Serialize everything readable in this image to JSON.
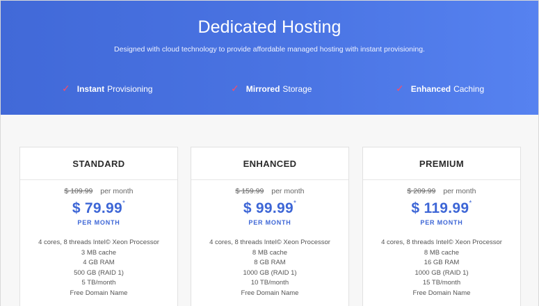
{
  "hero": {
    "title_light": "Dedicated",
    "title_bold": "Hosting",
    "subtitle": "Designed with cloud technology to provide affordable managed hosting with instant provisioning.",
    "features": [
      {
        "bold": "Instant",
        "rest": "Provisioning"
      },
      {
        "bold": "Mirrored",
        "rest": "Storage"
      },
      {
        "bold": "Enhanced",
        "rest": "Caching"
      }
    ]
  },
  "colors": {
    "hero_gradient_start": "#4169d8",
    "hero_gradient_end": "#5682f0",
    "accent_blue": "#3d66d6",
    "check_red": "#ff4b63"
  },
  "plans": [
    {
      "name": "STANDARD",
      "old_price": "$ 109.99",
      "per_month_text": "per month",
      "price": "$ 79.99",
      "price_mark": "*",
      "price_caption": "PER MONTH",
      "features": [
        "4 cores, 8 threads Intel© Xeon Processor",
        "3 MB cache",
        "4 GB RAM",
        "500 GB (RAID 1)",
        "5 TB/month",
        "Free Domain Name"
      ]
    },
    {
      "name": "ENHANCED",
      "old_price": "$ 159.99",
      "per_month_text": "per month",
      "price": "$ 99.99",
      "price_mark": "*",
      "price_caption": "PER MONTH",
      "features": [
        "4 cores, 8 threads Intel© Xeon Processor",
        "8 MB cache",
        "8 GB RAM",
        "1000 GB (RAID 1)",
        "10 TB/month",
        "Free Domain Name"
      ]
    },
    {
      "name": "PREMIUM",
      "old_price": "$ 209.99",
      "per_month_text": "per month",
      "price": "$ 119.99",
      "price_mark": "*",
      "price_caption": "PER MONTH",
      "features": [
        "4 cores, 8 threads Intel© Xeon Processor",
        "8 MB cache",
        "16 GB RAM",
        "1000 GB (RAID 1)",
        "15 TB/month",
        "Free Domain Name"
      ]
    }
  ]
}
